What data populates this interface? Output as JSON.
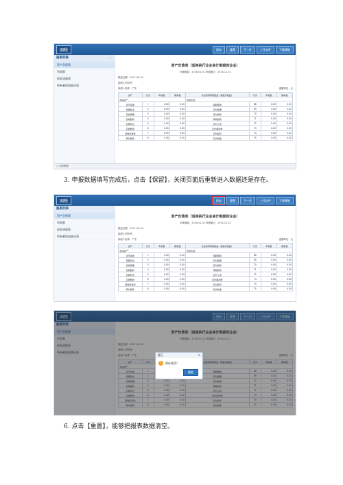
{
  "app": {
    "logo": "国税",
    "toolbar": [
      "保存",
      "重置",
      "下一步",
      "上传文件",
      "下载模板"
    ],
    "sidebar_header": "报表列表",
    "sidebar_items": [
      "资产负债表",
      "利润表",
      "现金流量表",
      "所有者权益变动表"
    ],
    "report_title": "资产负债表（适用执行企业会计制度的企业）",
    "period_line": "申报期起：2016-01-01  申报期止：2016-12-31",
    "fill_date": "报送日期：2017-06-16",
    "taxpayer_id": "纳税人识别号：",
    "taxpayer_name": "纳税人名称：广东",
    "unit": "金额单位：元",
    "table_headers": [
      "资产",
      "行次",
      "年初数",
      "期末数",
      "负债和所有者权益（或股东权益）",
      "行次",
      "年初数",
      "期末数"
    ],
    "section_left": "流动资产：",
    "section_right": "流动负债：",
    "rows": [
      {
        "l": "货币资金",
        "ln": "1",
        "la": "0.00",
        "lb": "0.00",
        "r": "短期借款",
        "rn": "68",
        "ra": "0.00",
        "rb": "0.00"
      },
      {
        "l": "短期投资",
        "ln": "2",
        "la": "0.00",
        "lb": "0.00",
        "r": "应付票据",
        "rn": "69",
        "ra": "0.00",
        "rb": "0.00"
      },
      {
        "l": "应收票据",
        "ln": "3",
        "la": "0.00",
        "lb": "0.00",
        "r": "应付账款",
        "rn": "70",
        "ra": "0.00",
        "rb": "0.00"
      },
      {
        "l": "应收股利",
        "ln": "4",
        "la": "0.00",
        "lb": "0.00",
        "r": "预收账款",
        "rn": "71",
        "ra": "0.00",
        "rb": "0.00"
      },
      {
        "l": "应收利息",
        "ln": "5",
        "la": "0.00",
        "lb": "0.00",
        "r": "应付工资",
        "rn": "72",
        "ra": "0.00",
        "rb": "0.00"
      },
      {
        "l": "应收账款",
        "ln": "6",
        "la": "0.00",
        "lb": "0.00",
        "r": "应付福利费",
        "rn": "73",
        "ra": "0.00",
        "rb": "0.00"
      },
      {
        "l": "其他应收款",
        "ln": "7",
        "la": "0.00",
        "lb": "0.00",
        "r": "应付股利",
        "rn": "74",
        "ra": "0.00",
        "rb": "0.00"
      },
      {
        "l": "预付账款",
        "ln": "8",
        "la": "0.00",
        "lb": "0.00",
        "r": "应交税金",
        "rn": "75",
        "ra": "0.00",
        "rb": "0.00"
      }
    ],
    "status_left": "◎ 中国联通",
    "dialog_title": "提示",
    "dialog_msg": "保存成功！",
    "dialog_ok": "确定"
  },
  "captions": {
    "step3": "3. 申报数据填写完成后，点击【保留】，关闭页面后重新进入数据还是存在。",
    "step6": "6. 点击【重置】，能够把报表数据清空。"
  }
}
